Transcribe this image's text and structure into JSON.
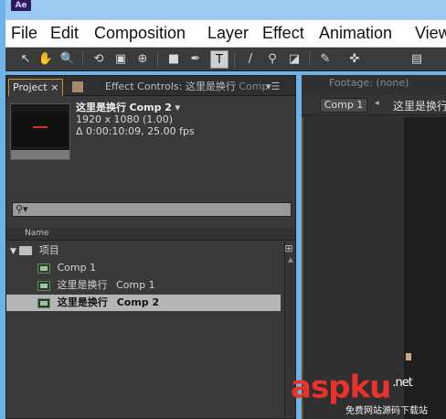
{
  "app": {
    "logo": "Ae"
  },
  "menubar": {
    "items": [
      "File",
      "Edit",
      "Composition",
      "Layer",
      "Effect",
      "Animation",
      "View"
    ]
  },
  "toolbar": {
    "tools": [
      {
        "name": "selection-tool",
        "glyph": "↖"
      },
      {
        "name": "hand-tool",
        "glyph": "✋"
      },
      {
        "name": "zoom-tool",
        "glyph": "🔍"
      },
      {
        "name": "rotation-tool",
        "glyph": "⟲"
      },
      {
        "name": "camera-tool",
        "glyph": "▣"
      },
      {
        "name": "pan-behind-tool",
        "glyph": "⊕"
      },
      {
        "name": "rectangle-tool",
        "glyph": "■"
      },
      {
        "name": "pen-tool",
        "glyph": "✒"
      },
      {
        "name": "type-tool",
        "glyph": "T"
      },
      {
        "name": "brush-tool",
        "glyph": "/"
      },
      {
        "name": "clone-stamp-tool",
        "glyph": "⚲"
      },
      {
        "name": "eraser-tool",
        "glyph": "◪"
      },
      {
        "name": "roto-brush-tool",
        "glyph": "✎"
      },
      {
        "name": "puppet-pin-tool",
        "glyph": "✜"
      },
      {
        "name": "workspace-icon",
        "glyph": "▤"
      }
    ],
    "active_tool": "type-tool"
  },
  "project_panel": {
    "tab_label": "Project",
    "tab_close": "×",
    "effect_controls_label": "Effect Controls: 这里是换行",
    "effect_controls_trailing": "Comp",
    "panel_menu_glyph": "▾☰",
    "selected_item": {
      "name": "这里是换行",
      "comp": "Comp 2",
      "dropdown_glyph": "▾",
      "resolution": "1920 x 1080 (1.00)",
      "duration": "Δ 0:00:10:09, 25.00 fps"
    },
    "search": {
      "glyph": "⚲▾",
      "value": ""
    },
    "column_header": "Name",
    "items": [
      {
        "type": "folder",
        "label": "项目",
        "sub": ""
      },
      {
        "type": "comp",
        "label": "Comp 1",
        "sub": ""
      },
      {
        "type": "comp",
        "label": "这里是换行",
        "sub": "Comp 1"
      },
      {
        "type": "comp",
        "label": "这里是换行",
        "sub": "Comp 2",
        "selected": true
      }
    ]
  },
  "viewer_panel": {
    "footage_label": "Footage: (none)",
    "comp_button": "Comp 1",
    "nav_arrow": "◂",
    "comp_name": "这里是换行"
  },
  "watermark": {
    "text": "aspku",
    "suffix": ".net",
    "subtitle": "免费网站源码下载站"
  },
  "colors": {
    "accent_tab_border": "#c89830",
    "selection_bg": "#b5b5b5",
    "watermark": "#e8322b"
  }
}
